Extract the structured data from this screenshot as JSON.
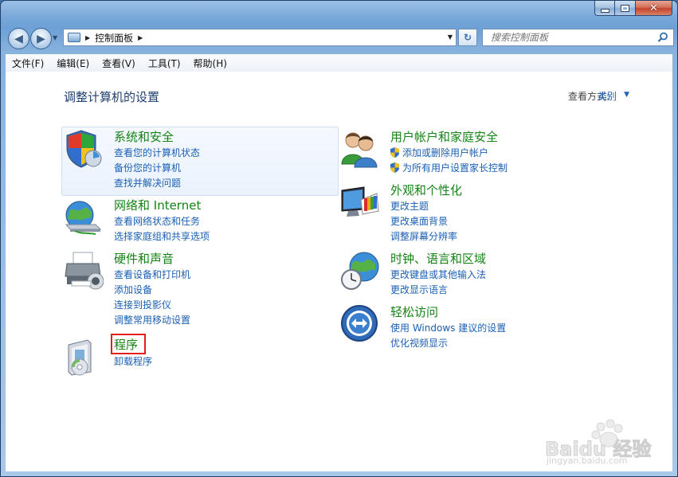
{
  "window": {
    "buttons": {
      "close": "✕"
    }
  },
  "navigation": {
    "address_path": "控制面板",
    "search_placeholder": "搜索控制面板"
  },
  "menu": [
    "文件(F)",
    "编辑(E)",
    "查看(V)",
    "工具(T)",
    "帮助(H)"
  ],
  "page": {
    "title": "调整计算机的设置",
    "view_by_label": "查看方式:",
    "view_by_value": "类别"
  },
  "categories": [
    {
      "title": "系统和安全",
      "links": [
        "查看您的计算机状态",
        "备份您的计算机",
        "查找并解决问题"
      ],
      "icon": "shield-icon"
    },
    {
      "title": "网络和 Internet",
      "links": [
        "查看网络状态和任务",
        "选择家庭组和共享选项"
      ],
      "icon": "globe-network-icon"
    },
    {
      "title": "硬件和声音",
      "links": [
        "查看设备和打印机",
        "添加设备",
        "连接到投影仪",
        "调整常用移动设置"
      ],
      "icon": "printer-icon"
    },
    {
      "title": "程序",
      "links": [
        "卸载程序"
      ],
      "icon": "programs-icon"
    },
    {
      "title": "用户帐户和家庭安全",
      "links": [
        "添加或删除用户帐户",
        "为所有用户设置家长控制"
      ],
      "icon": "users-icon"
    },
    {
      "title": "外观和个性化",
      "links": [
        "更改主题",
        "更改桌面背景",
        "调整屏幕分辨率"
      ],
      "icon": "monitor-palette-icon"
    },
    {
      "title": "时钟、语言和区域",
      "links": [
        "更改键盘或其他输入法",
        "更改显示语言"
      ],
      "icon": "globe-clock-icon"
    },
    {
      "title": "轻松访问",
      "links": [
        "使用 Windows 建议的设置",
        "优化视频显示"
      ],
      "icon": "ease-of-access-icon"
    }
  ],
  "watermark": {
    "brand": "Baidu 经验",
    "url": "jingyan.baidu.com"
  },
  "colors": {
    "title_green": "#138413",
    "link_blue": "#1a5fb4",
    "highlight_red": "#e0201b"
  }
}
